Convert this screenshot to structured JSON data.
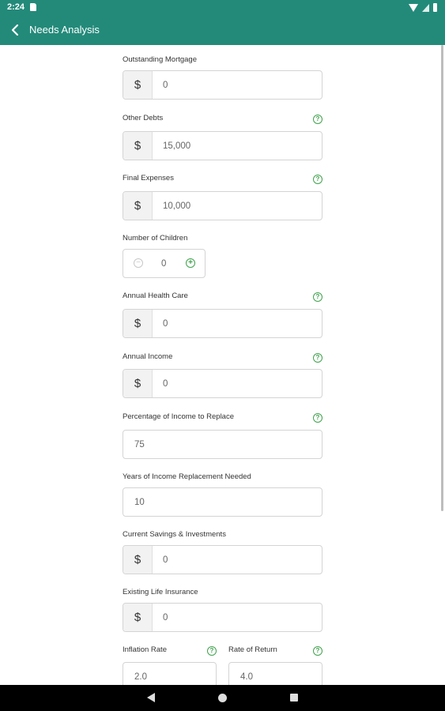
{
  "status_bar": {
    "time": "2:24"
  },
  "app_bar": {
    "title": "Needs Analysis"
  },
  "fields": {
    "outstanding_mortgage": {
      "label": "Outstanding Mortgage",
      "prefix": "$",
      "value": "0"
    },
    "other_debts": {
      "label": "Other Debts",
      "prefix": "$",
      "value": "15,000"
    },
    "final_expenses": {
      "label": "Final Expenses",
      "prefix": "$",
      "value": "10,000"
    },
    "number_of_children": {
      "label": "Number of Children",
      "value": "0",
      "minus": "−",
      "plus": "+"
    },
    "annual_health_care": {
      "label": "Annual Health Care",
      "prefix": "$",
      "value": "0"
    },
    "annual_income": {
      "label": "Annual Income",
      "prefix": "$",
      "value": "0"
    },
    "percentage_income_replace": {
      "label": "Percentage of Income to Replace",
      "value": "75"
    },
    "years_income_replacement": {
      "label": "Years of Income Replacement Needed",
      "value": "10"
    },
    "current_savings": {
      "label": "Current Savings & Investments",
      "prefix": "$",
      "value": "0"
    },
    "existing_life_insurance": {
      "label": "Existing Life Insurance",
      "prefix": "$",
      "value": "0"
    },
    "inflation_rate": {
      "label": "Inflation Rate",
      "value": "2.0"
    },
    "rate_of_return": {
      "label": "Rate of Return",
      "value": "4.0"
    }
  },
  "help_glyph": "?",
  "colors": {
    "primary": "#238a7a",
    "accent": "#3fa34d"
  },
  "icons": [
    "back-arrow-icon",
    "help-icon",
    "minus-circle-icon",
    "plus-circle-icon",
    "wifi-icon",
    "signal-icon",
    "battery-icon",
    "sd-card-icon"
  ]
}
